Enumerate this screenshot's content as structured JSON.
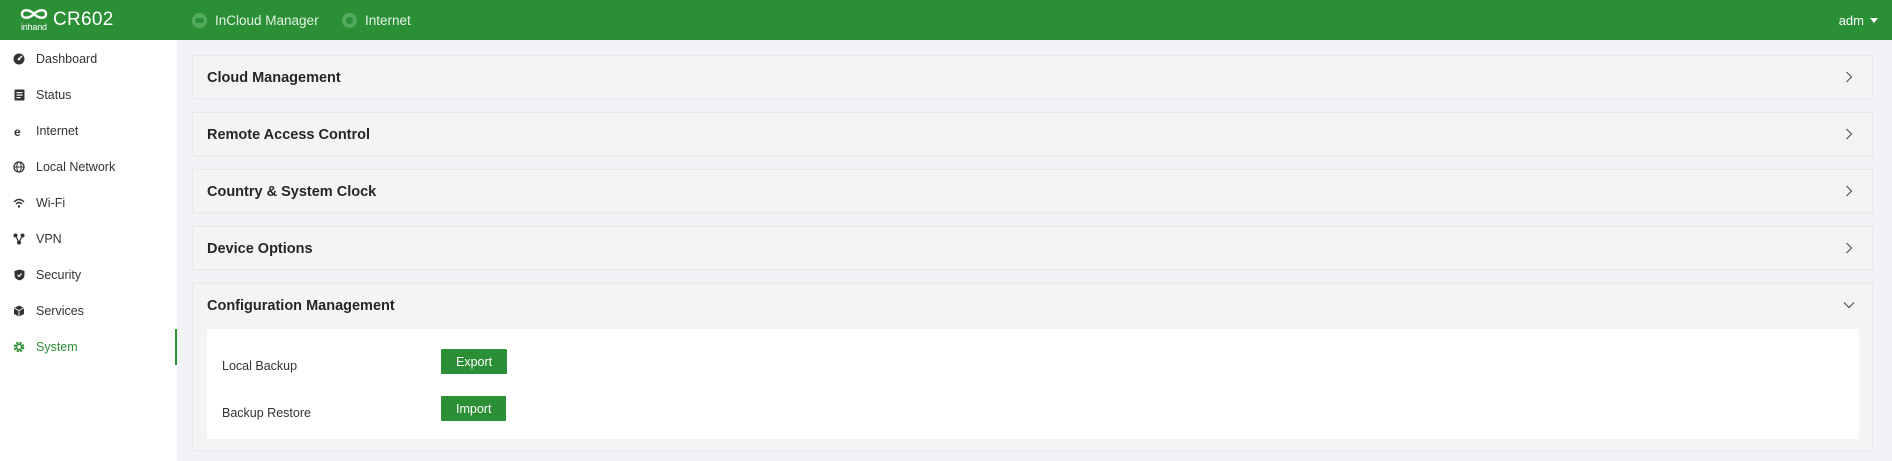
{
  "brand": {
    "logo_sub": "inhand",
    "model": "CR602"
  },
  "topnav": [
    {
      "label": "InCloud Manager",
      "icon": "cloud-icon"
    },
    {
      "label": "Internet",
      "icon": "globe-icon"
    }
  ],
  "user": {
    "name": "adm"
  },
  "sidebar": {
    "items": [
      {
        "label": "Dashboard",
        "icon": "dashboard-icon"
      },
      {
        "label": "Status",
        "icon": "status-icon"
      },
      {
        "label": "Internet",
        "icon": "internet-icon"
      },
      {
        "label": "Local Network",
        "icon": "globe-icon"
      },
      {
        "label": "Wi-Fi",
        "icon": "wifi-icon"
      },
      {
        "label": "VPN",
        "icon": "vpn-icon"
      },
      {
        "label": "Security",
        "icon": "shield-icon"
      },
      {
        "label": "Services",
        "icon": "cube-icon"
      },
      {
        "label": "System",
        "icon": "gear-icon",
        "active": true
      }
    ]
  },
  "sections": [
    {
      "title": "Cloud Management",
      "expanded": false
    },
    {
      "title": "Remote Access Control",
      "expanded": false
    },
    {
      "title": "Country & System Clock",
      "expanded": false
    },
    {
      "title": "Device Options",
      "expanded": false
    },
    {
      "title": "Configuration Management",
      "expanded": true
    }
  ],
  "config_management": {
    "rows": [
      {
        "label": "Local Backup",
        "button": "Export"
      },
      {
        "label": "Backup Restore",
        "button": "Import"
      }
    ]
  },
  "colors": {
    "primary": "#2b8f36",
    "panel": "#f4f4f4",
    "background": "#f0f2f5"
  }
}
